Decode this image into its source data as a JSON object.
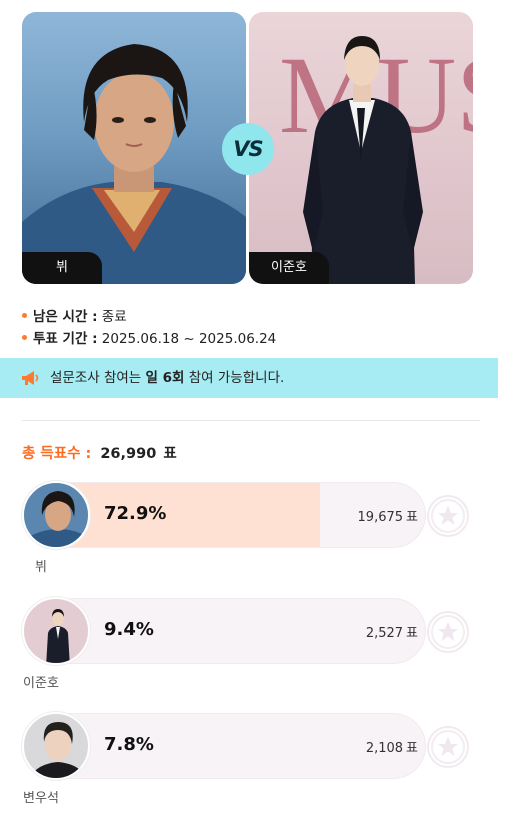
{
  "matchup": {
    "left": {
      "name": "뷔"
    },
    "vs_label": "VS",
    "right": {
      "name": "이준호",
      "backdrop_text": "MUST"
    }
  },
  "info": {
    "remaining_label": "남은 시간 :",
    "remaining_value": "종료",
    "period_label": "투표 기간 :",
    "period_value": "2025.06.18 ~ 2025.06.24"
  },
  "notice": {
    "icon": "megaphone-icon",
    "prefix": "설문조사 참여는 ",
    "highlight": "일 6회",
    "suffix": " 참여 가능합니다."
  },
  "total": {
    "label": "총 득표수 :",
    "value": "26,990",
    "unit": "표"
  },
  "vote_unit": "표",
  "candidates": [
    {
      "name": "뷔",
      "percent": "72.9%",
      "share": 0.729,
      "votes": "19,675"
    },
    {
      "name": "이준호",
      "percent": "9.4%",
      "share": 0.094,
      "votes": "2,527"
    },
    {
      "name": "변우석",
      "percent": "7.8%",
      "share": 0.078,
      "votes": "2,108"
    }
  ],
  "colors": {
    "accent": "#ff6a1f",
    "notice_bg": "#a6ecf2",
    "vs_badge": "#8fe6ec",
    "bar_fill": "#ffe1d3"
  }
}
